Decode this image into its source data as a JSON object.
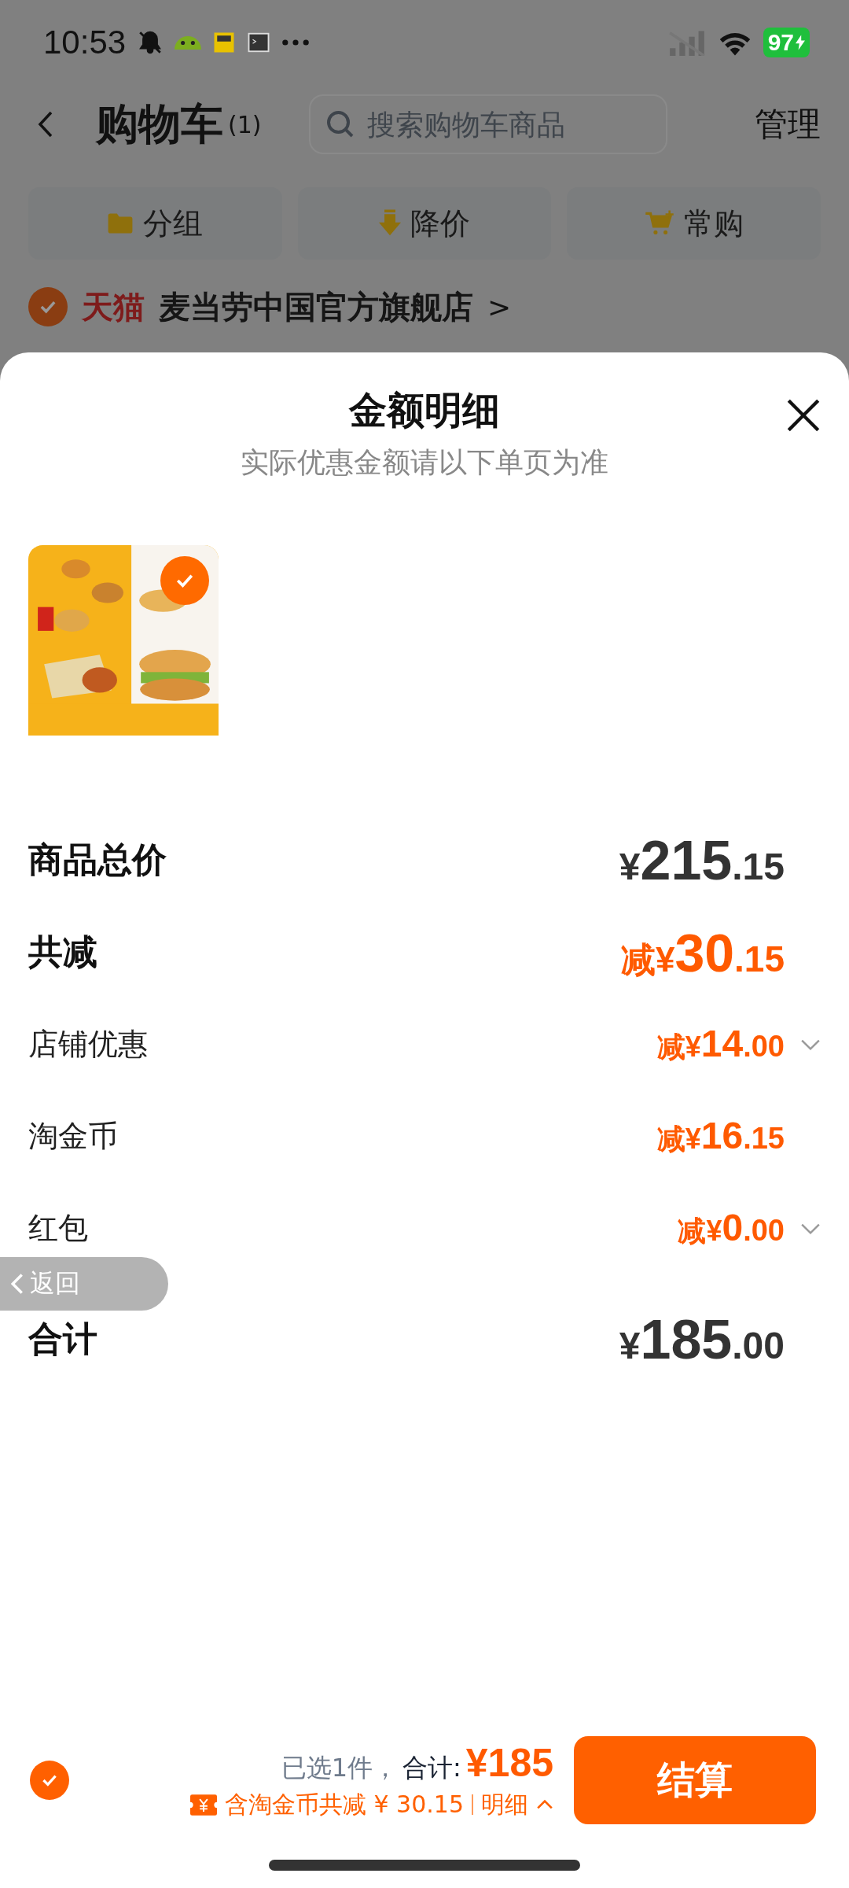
{
  "status_bar": {
    "time": "10:53",
    "battery": "97"
  },
  "header": {
    "title": "购物车",
    "count": "(1)",
    "search": {
      "placeholder": "搜索购物车商品"
    },
    "action": "管理"
  },
  "shortcuts": [
    {
      "label": "分组",
      "kind": "folder"
    },
    {
      "label": "降价",
      "kind": "price-drop"
    },
    {
      "label": "常购",
      "kind": "cart"
    }
  ],
  "store": {
    "badge": "天猫",
    "name": "麦当劳中国官方旗舰店",
    "chevron": ">",
    "checked": true
  },
  "sheet": {
    "title": "金额明细",
    "subtitle": "实际优惠金额请以下单页为准",
    "products": [
      {
        "kind": "picture",
        "checked": true
      }
    ],
    "rows": [
      {
        "label": "商品总价",
        "kind": "total",
        "prefix": "",
        "currency": "¥",
        "integer": "215",
        "decimal": ".15",
        "expandable": false
      },
      {
        "label": "共减",
        "kind": "discount_total",
        "prefix": "减",
        "currency": "¥",
        "integer": "30",
        "decimal": ".15",
        "expandable": false
      },
      {
        "label": "店铺优惠",
        "kind": "discount",
        "prefix": "减",
        "currency": "¥",
        "integer": "14",
        "decimal": ".00",
        "expandable": true
      },
      {
        "label": "淘金币",
        "kind": "discount",
        "prefix": "减",
        "currency": "¥",
        "integer": "16",
        "decimal": ".15",
        "expandable": false
      },
      {
        "label": "红包",
        "kind": "discount",
        "prefix": "减",
        "currency": "¥",
        "integer": "0",
        "decimal": ".00",
        "expandable": true
      },
      {
        "label": "合计",
        "kind": "total",
        "prefix": "",
        "currency": "¥",
        "integer": "185",
        "decimal": ".00",
        "expandable": false
      }
    ]
  },
  "back_button": {
    "label": "返回"
  },
  "footer": {
    "checked": true,
    "selected": "已选1件，",
    "total_label": "合计:",
    "total": "¥185",
    "savings": "含淘金币共减 ¥ 30.15",
    "detail": "明细",
    "expanded": true,
    "checkout": "结算"
  }
}
